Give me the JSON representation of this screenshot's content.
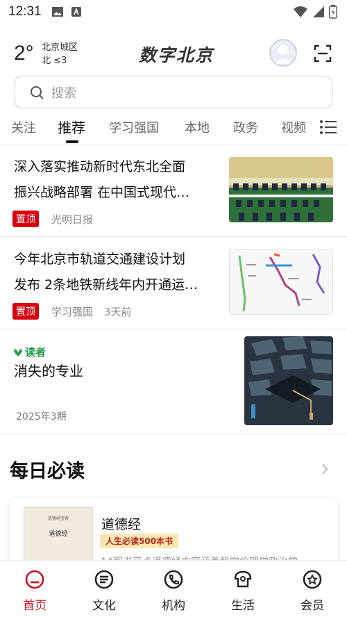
{
  "status_bar": {
    "time": "12:31"
  },
  "header": {
    "temperature": "2°",
    "location": "北京城区",
    "wind": "北 ≤3",
    "brand": "数字北京"
  },
  "search": {
    "placeholder": "搜索"
  },
  "tabs": [
    {
      "label": "关注"
    },
    {
      "label": "推荐",
      "active": true
    },
    {
      "label": "学习强国"
    },
    {
      "label": "本地"
    },
    {
      "label": "政务"
    },
    {
      "label": "视频"
    }
  ],
  "news": [
    {
      "title_line1": "深入落实推动新时代东北全面",
      "title_line2": "振兴战略部署  在中国式现代…",
      "badge": "置顶",
      "source": "光明日报",
      "time": ""
    },
    {
      "title_line1": "今年北京市轨道交通建设计划",
      "title_line2": "发布 2条地铁新线年内开通运…",
      "badge": "置顶",
      "source": "学习强国",
      "time": "3天前"
    }
  ],
  "magazine": {
    "logo": "读者",
    "title": "消失的专业",
    "issue": "2025年3期"
  },
  "daily": {
    "section_title": "每日必读",
    "book": {
      "cover_small": "道德经宝典",
      "cover_title": "道德经",
      "name": "道德经",
      "tag": "人生必读500本书",
      "desc": "14图书亮点道德经内容涵盖哲学伦理学政治学"
    }
  },
  "bottom_nav": [
    {
      "label": "首页",
      "active": true
    },
    {
      "label": "文化"
    },
    {
      "label": "机构"
    },
    {
      "label": "生活"
    },
    {
      "label": "会员"
    }
  ],
  "colors": {
    "accent": "#c3121b",
    "badge": "#d7000f",
    "magazine_green": "#1c9b47"
  }
}
